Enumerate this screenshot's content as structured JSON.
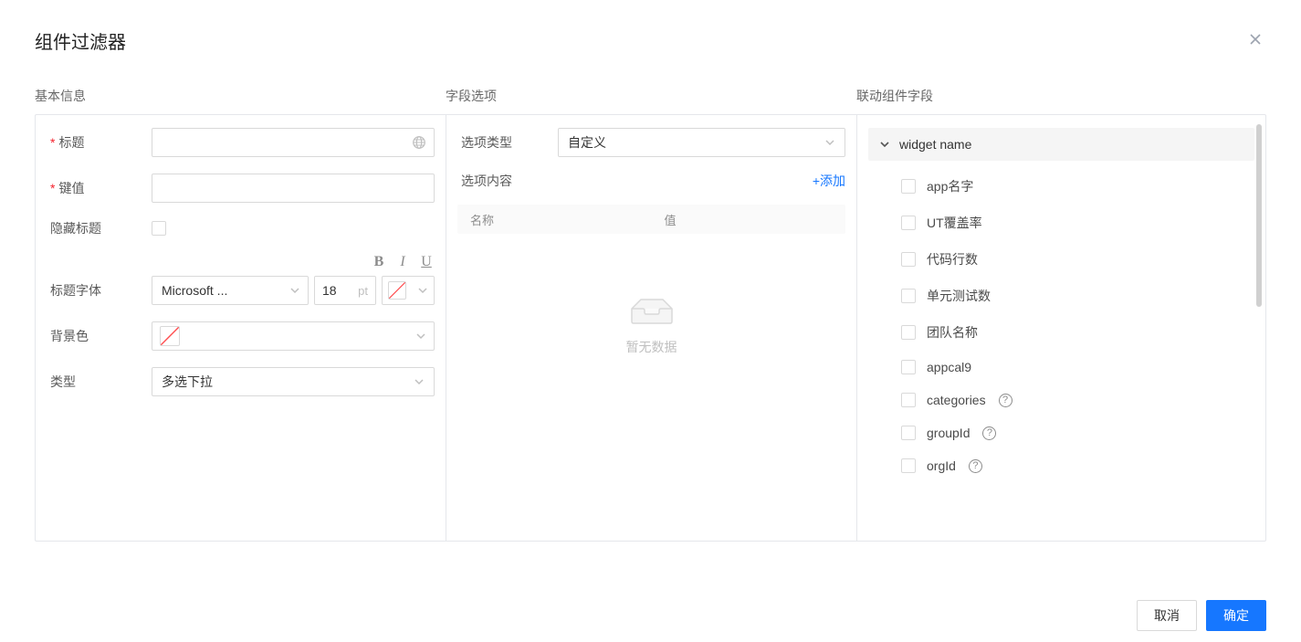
{
  "modal": {
    "title": "组件过滤器",
    "close_icon": "×"
  },
  "sections": {
    "basic": "基本信息",
    "options": "字段选项",
    "linked": "联动组件字段"
  },
  "basic": {
    "title_label": "标题",
    "key_label": "键值",
    "hide_title_label": "隐藏标题",
    "title_font_label": "标题字体",
    "font_value": "Microsoft ...",
    "font_size": "18",
    "font_unit": "pt",
    "bg_label": "背景色",
    "type_label": "类型",
    "type_value": "多选下拉"
  },
  "options": {
    "type_label": "选项类型",
    "type_value": "自定义",
    "content_label": "选项内容",
    "add_label": "+添加",
    "col_name": "名称",
    "col_value": "值",
    "empty": "暂无数据"
  },
  "linked": {
    "group_name": "widget name",
    "fields": [
      {
        "label": "app名字",
        "help": false
      },
      {
        "label": "UT覆盖率",
        "help": false
      },
      {
        "label": "代码行数",
        "help": false
      },
      {
        "label": "单元测试数",
        "help": false
      },
      {
        "label": "团队名称",
        "help": false
      },
      {
        "label": "appcal9",
        "help": false
      },
      {
        "label": "categories",
        "help": true
      },
      {
        "label": "groupId",
        "help": true
      },
      {
        "label": "orgId",
        "help": true
      }
    ]
  },
  "footer": {
    "cancel": "取消",
    "ok": "确定"
  }
}
